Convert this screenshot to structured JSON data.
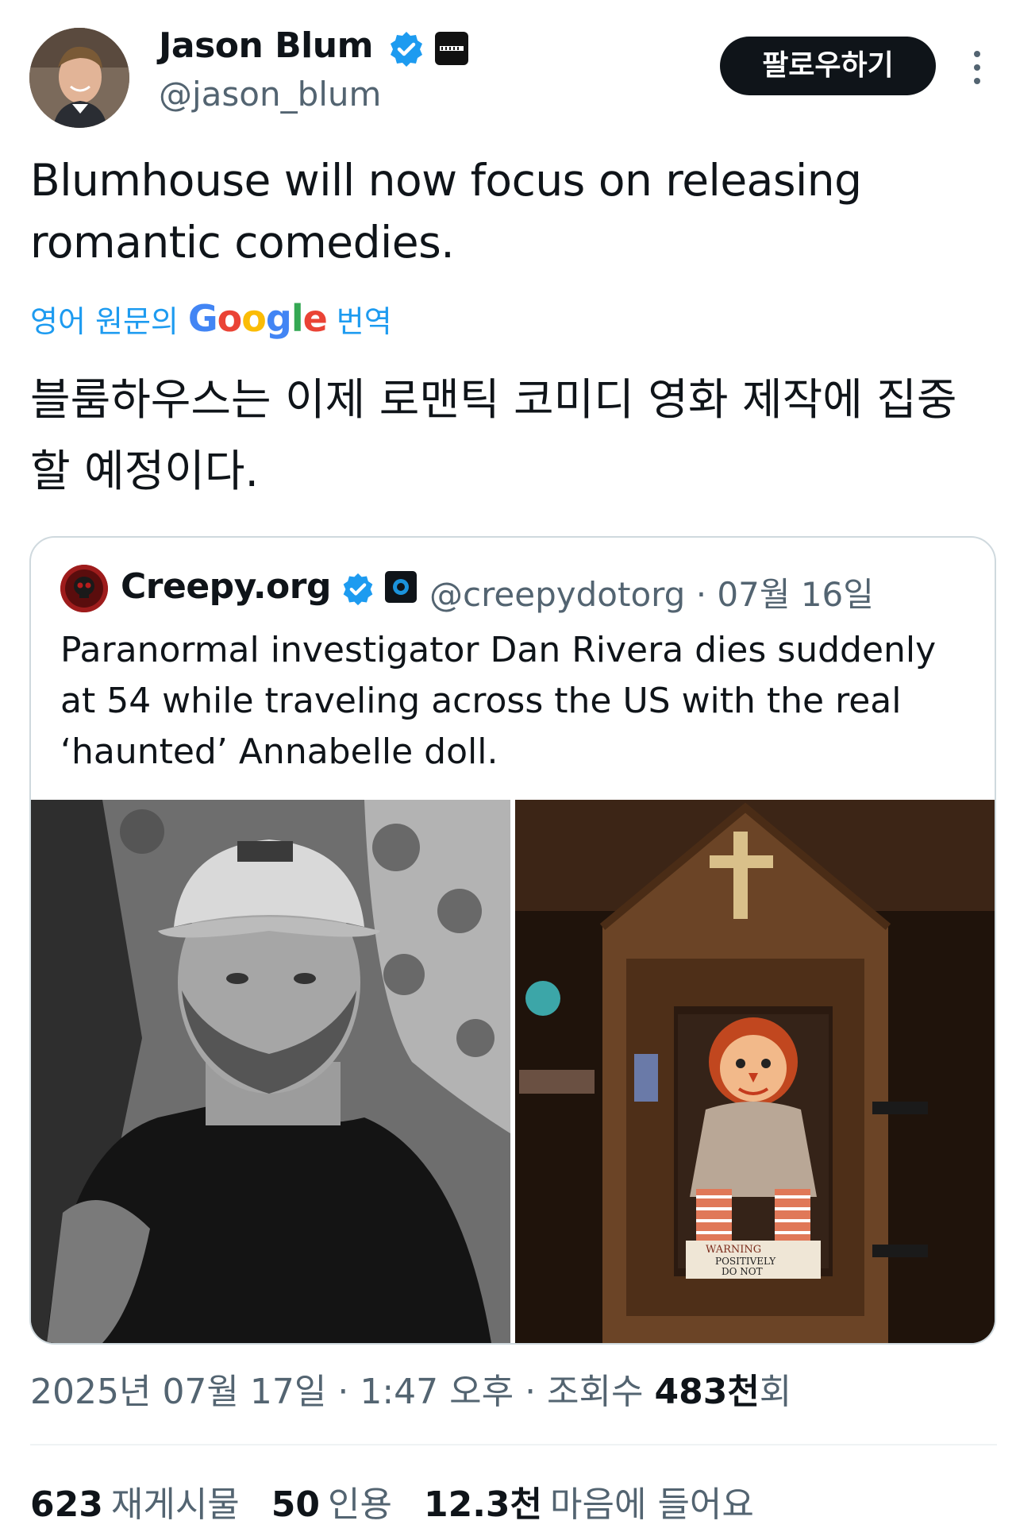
{
  "author": {
    "name": "Jason Blum",
    "handle": "@jason_blum",
    "affiliation_icon": "blumhouse-logo-badge",
    "verified_icon": "verified-badge-icon"
  },
  "follow_button": "팔로우하기",
  "tweet": {
    "text": "Blumhouse will now focus on releasing romantic comedies.",
    "translate_prefix": "영어 원문의",
    "translate_brand": "Google",
    "translate_suffix": "번역",
    "translated_text": "블룸하우스는 이제 로맨틱 코미디 영화 제작에 집중할 예정이다."
  },
  "quote": {
    "name": "Creepy.org",
    "handle": "@creepydotorg",
    "date": "· 07월 16일",
    "text": "Paranormal investigator Dan Rivera dies suddenly at 54 while traveling across the US with the real ‘haunted’ Annabelle doll.",
    "images": [
      "man-in-cap-photo",
      "annabelle-doll-case-photo"
    ],
    "sign_lines": [
      "WARNING",
      "POSITIVELY",
      "DO NOT"
    ]
  },
  "timestamp": {
    "text": "2025년 07월 17일 · 1:47 오후 · 조회수 ",
    "views": "483천",
    "views_suffix": "회"
  },
  "stats": [
    {
      "num": "623",
      "label": "재게시물"
    },
    {
      "num": "50",
      "label": "인용"
    },
    {
      "num": "12.3천",
      "label": "마음에 들어요"
    }
  ],
  "colors": {
    "accent": "#1d9bf0",
    "text": "#0f1419",
    "secondary": "#536471",
    "border": "#cfd9de"
  }
}
